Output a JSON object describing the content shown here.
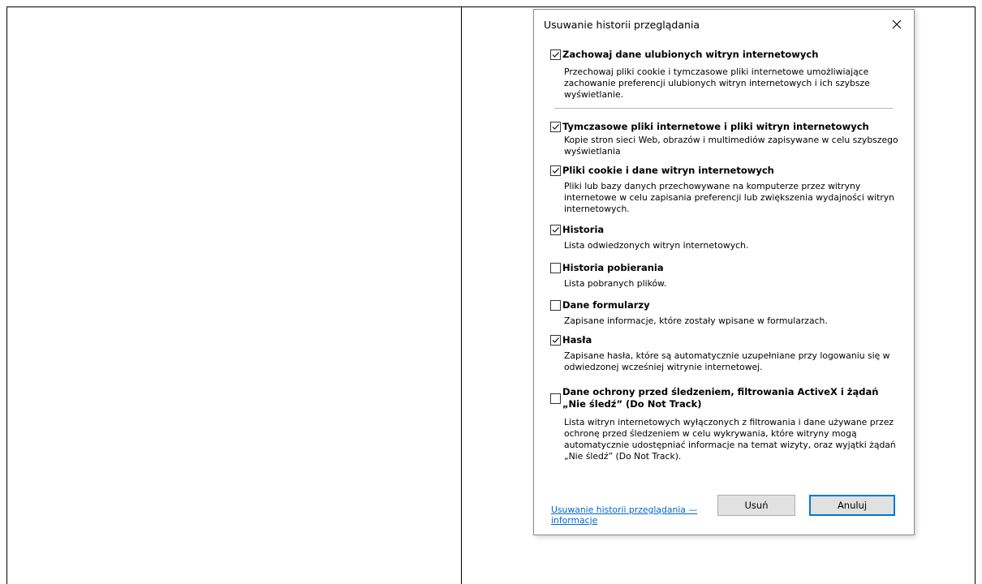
{
  "dialog": {
    "title": "Usuwanie historii przeglądania",
    "close_icon": "close-icon",
    "preserve_favorites": {
      "label": "Zachowaj dane ulubionych witryn internetowych",
      "description": "Przechowaj pliki cookie i tymczasowe pliki internetowe umożliwiające zachowanie preferencji ulubionych witryn internetowych i ich szybsze wyświetlanie.",
      "checked": true
    },
    "options": [
      {
        "label": "Tymczasowe pliki internetowe i pliki witryn internetowych",
        "description": "Kopie stron sieci Web, obrazów i multimediów zapisywane w celu szybszego wyświetlania",
        "checked": true
      },
      {
        "label": "Pliki cookie i dane witryn internetowych",
        "description": "Pliki lub bazy danych przechowywane na komputerze przez witryny internetowe w celu zapisania preferencji lub zwiększenia wydajności witryn internetowych.",
        "checked": true
      },
      {
        "label": "Historia",
        "description": "Lista odwiedzonych witryn internetowych.",
        "checked": true
      },
      {
        "label": "Historia pobierania",
        "description": "Lista pobranych plików.",
        "checked": false
      },
      {
        "label": "Dane formularzy",
        "description": "Zapisane informacje, które zostały wpisane w formularzach.",
        "checked": false
      },
      {
        "label": "Hasła",
        "description": "Zapisane hasła, które są automatycznie uzupełniane przy logowaniu się w odwiedzonej wcześniej witrynie internetowej.",
        "checked": true
      },
      {
        "label": "Dane ochrony przed śledzeniem, filtrowania ActiveX i żądań „Nie śledź” (Do Not Track)",
        "description": "Lista witryn internetowych wyłączonych z filtrowania i dane używane przez ochronę przed śledzeniem w celu wykrywania, które witryny mogą automatycznie udostępniać informacje na temat wizyty, oraz wyjątki żądań „Nie śledź” (Do Not Track).",
        "checked": false
      }
    ],
    "info_link": "Usuwanie historii przeglądania — informacje",
    "delete_button": "Usuń",
    "cancel_button": "Anuluj"
  },
  "colors": {
    "link": "#0066cc",
    "button_bg": "#e1e1e1",
    "default_button_border": "#0078d7"
  }
}
